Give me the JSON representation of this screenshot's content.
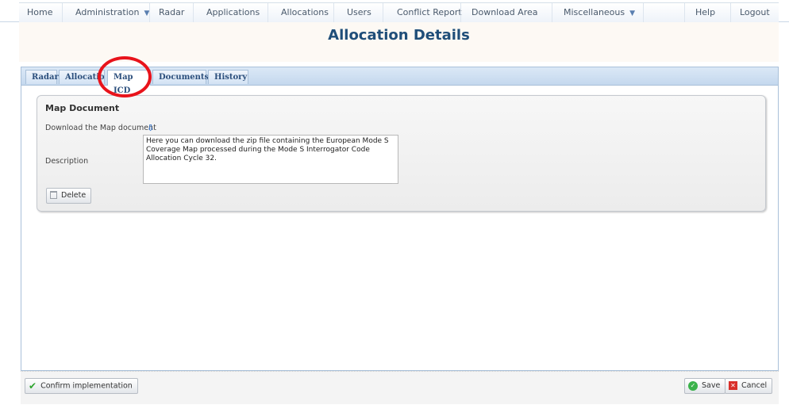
{
  "nav": {
    "items": [
      {
        "label": "Home"
      },
      {
        "label": "Administration",
        "dropdown": true
      },
      {
        "label": "Radar"
      },
      {
        "label": "Applications"
      },
      {
        "label": "Allocations"
      },
      {
        "label": "Users"
      },
      {
        "label": "Conflict Report"
      },
      {
        "label": "Download Area"
      },
      {
        "label": "Miscellaneous",
        "dropdown": true
      },
      {
        "label": "Help"
      },
      {
        "label": "Logout"
      }
    ],
    "caret": "▼"
  },
  "page": {
    "title": "Allocation Details"
  },
  "tabs": [
    {
      "label": "Radar"
    },
    {
      "label": "Allocatio"
    },
    {
      "label": "Map ICD",
      "active": true
    },
    {
      "label": "Documents"
    },
    {
      "label": "History"
    }
  ],
  "map_document": {
    "title": "Map Document",
    "download_label": "Download the Map document",
    "download_icon": "download-arrow-icon",
    "description_label": "Description",
    "description_value": "Here you can download the zip file containing the European Mode S Coverage Map processed during the Mode S Interrogator Code Allocation Cycle 32.",
    "delete_label": "Delete"
  },
  "footer": {
    "confirm_label": "Confirm implementation",
    "save_label": "Save",
    "cancel_label": "Cancel"
  },
  "colors": {
    "title": "#1f4e79",
    "highlight": "#e8131b",
    "tab_bar": "#c4d8ee"
  }
}
